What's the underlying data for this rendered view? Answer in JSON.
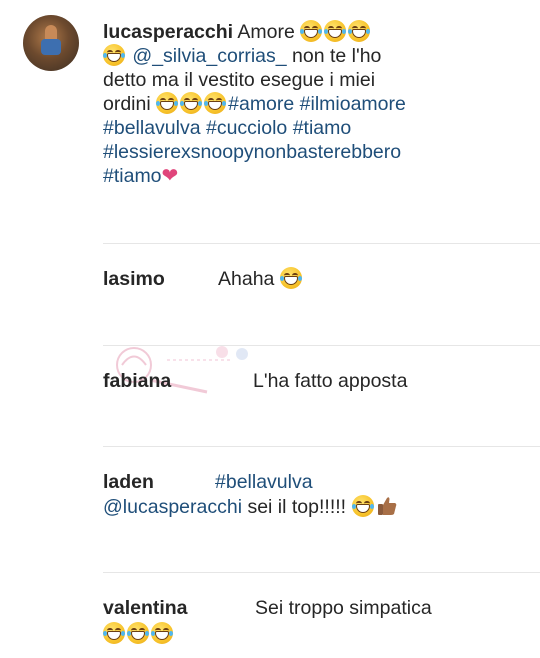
{
  "post": {
    "username": "lucasperacchi",
    "caption_word": "Amore",
    "mention": "@_silvia_corrias_",
    "text_a": " non te l'ho",
    "text_b": "detto ma il vestito esegue i miei",
    "text_c": "ordini ",
    "hashtags_1": "#amore #ilmioamore",
    "hashtags_2": "#bellavulva #cucciolo #tiamo",
    "hashtags_3": "#lessierexsnoopynonbasterebbero",
    "hashtags_4": "#tiamo"
  },
  "comments": [
    {
      "username": "lasimo",
      "text": "Ahaha "
    },
    {
      "username": "fabiana",
      "text": "L'ha fatto apposta"
    },
    {
      "username": "laden",
      "hashtag": "#bellavulva",
      "mention": "@lucasperacchi",
      "text": "  sei il top!!!!! "
    },
    {
      "username": "valentina",
      "text": "Sei troppo simpatica"
    }
  ],
  "icons": {
    "laugh": "grinning-squinting-tears-emoji",
    "heart": "pink-heart-emoji",
    "thumb": "thumbs-up-emoji"
  },
  "colors": {
    "link": "#1f4e79",
    "heart": "#e0457b",
    "divider": "#e6e6e6"
  }
}
